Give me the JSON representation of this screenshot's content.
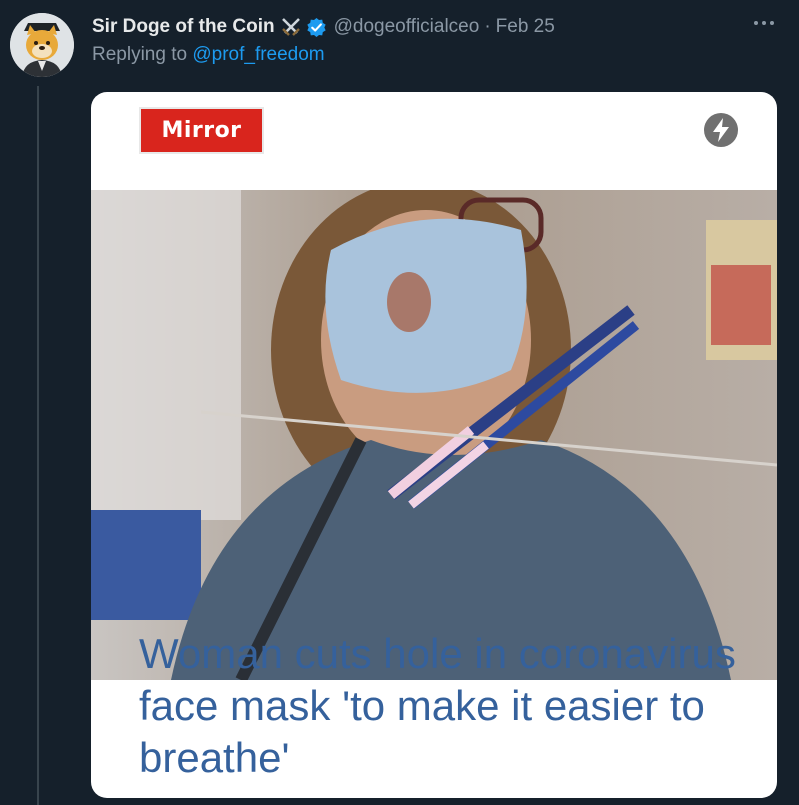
{
  "tweet": {
    "display_name": "Sir Doge of the Coin",
    "handle": "@dogeofficialceo",
    "separator": "·",
    "date": "Feb 25",
    "reply_prefix": "Replying to ",
    "reply_to": "@prof_freedom",
    "icons": [
      "swords-icon",
      "verified-icon",
      "more-icon"
    ]
  },
  "media": {
    "brand": "Mirror",
    "amp_icon": "lightning-bolt-icon",
    "headline": "Woman cuts hole in coronavirus face mask 'to make it easier to breathe'"
  },
  "colors": {
    "background": "#15202b",
    "accent": "#1d9bf0",
    "brand_red": "#d9251d",
    "headline_blue": "#35619c"
  }
}
